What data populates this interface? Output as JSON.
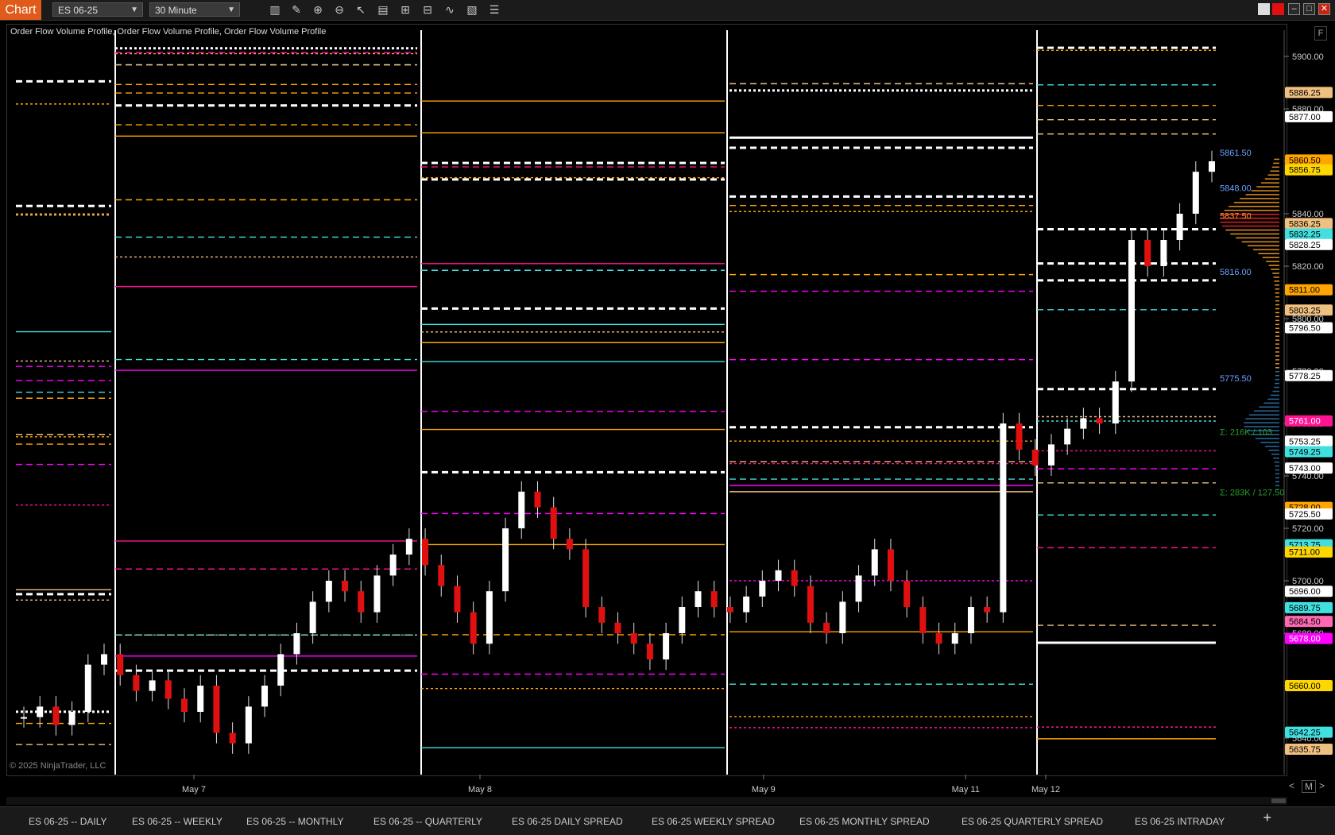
{
  "toolbar": {
    "chart_tab": "Chart",
    "instrument": "ES 06-25",
    "interval": "30 Minute",
    "icons": [
      "bars-icon",
      "pencil-icon",
      "zoom-in-icon",
      "zoom-out-icon",
      "pointer-icon",
      "data-box-icon",
      "properties-icon",
      "strategies-icon",
      "indicators-icon",
      "templates-icon",
      "list-icon"
    ]
  },
  "window": {
    "minimize": "–",
    "maximize": "□",
    "close": "✕"
  },
  "chart": {
    "indicator_label": "Order Flow Volume Profile, Order Flow Volume Profile, Order Flow Volume Profile",
    "copyright": "© 2025 NinjaTrader, LLC",
    "f_button": "F",
    "nav_left": "<",
    "nav_mode": "M",
    "nav_right": ">"
  },
  "chart_data": {
    "type": "candlestick",
    "instrument": "ES 06-25",
    "ylim": [
      5630,
      5910
    ],
    "y_ticks": [
      5900.0,
      5880.0,
      5860.0,
      5840.0,
      5820.0,
      5800.0,
      5780.0,
      5760.0,
      5740.0,
      5720.0,
      5700.0,
      5680.0,
      5660.0,
      5640.0
    ],
    "x_labels": [
      {
        "label": "May 7",
        "pos": 0.145
      },
      {
        "label": "May 8",
        "pos": 0.37
      },
      {
        "label": "May 9",
        "pos": 0.593
      },
      {
        "label": "May 11",
        "pos": 0.752
      },
      {
        "label": "May 12",
        "pos": 0.815
      }
    ],
    "price_markers": [
      {
        "value": "5886.25",
        "price": 5886.25,
        "bg": "#f0c080",
        "fg": "#000"
      },
      {
        "value": "5877.00",
        "price": 5877.0,
        "bg": "#ffffff",
        "fg": "#000"
      },
      {
        "value": "5860.50",
        "price": 5860.5,
        "bg": "#ffa500",
        "fg": "#000"
      },
      {
        "value": "5856.75",
        "price": 5856.75,
        "bg": "#ffd700",
        "fg": "#000"
      },
      {
        "value": "5836.25",
        "price": 5836.25,
        "bg": "#f0c080",
        "fg": "#000"
      },
      {
        "value": "5832.25",
        "price": 5832.25,
        "bg": "#40e0e0",
        "fg": "#000"
      },
      {
        "value": "5828.25",
        "price": 5828.25,
        "bg": "#ffffff",
        "fg": "#000"
      },
      {
        "value": "5811.00",
        "price": 5811.0,
        "bg": "#ffa500",
        "fg": "#000"
      },
      {
        "value": "5803.25",
        "price": 5803.25,
        "bg": "#f0c080",
        "fg": "#000"
      },
      {
        "value": "5796.50",
        "price": 5796.5,
        "bg": "#ffffff",
        "fg": "#000"
      },
      {
        "value": "5778.25",
        "price": 5778.25,
        "bg": "#ffffff",
        "fg": "#000"
      },
      {
        "value": "5761.00",
        "price": 5761.0,
        "bg": "#ff1493",
        "fg": "#fff"
      },
      {
        "value": "5753.25",
        "price": 5753.25,
        "bg": "#ffffff",
        "fg": "#000"
      },
      {
        "value": "5749.25",
        "price": 5749.25,
        "bg": "#40e0e0",
        "fg": "#000"
      },
      {
        "value": "5743.00",
        "price": 5743.0,
        "bg": "#ffffff",
        "fg": "#000"
      },
      {
        "value": "5728.00",
        "price": 5728.0,
        "bg": "#ffa500",
        "fg": "#000"
      },
      {
        "value": "5725.50",
        "price": 5725.5,
        "bg": "#ffffff",
        "fg": "#000"
      },
      {
        "value": "5713.75",
        "price": 5713.75,
        "bg": "#40e0e0",
        "fg": "#000"
      },
      {
        "value": "5711.00",
        "price": 5711.0,
        "bg": "#ffd700",
        "fg": "#000"
      },
      {
        "value": "5696.00",
        "price": 5696.0,
        "bg": "#ffffff",
        "fg": "#000"
      },
      {
        "value": "5689.75",
        "price": 5689.75,
        "bg": "#40e0e0",
        "fg": "#000"
      },
      {
        "value": "5684.50",
        "price": 5684.5,
        "bg": "#ff69b4",
        "fg": "#000"
      },
      {
        "value": "5678.00",
        "price": 5678.0,
        "bg": "#ff00ff",
        "fg": "#fff"
      },
      {
        "value": "5660.00",
        "price": 5660.0,
        "bg": "#ffd700",
        "fg": "#000"
      },
      {
        "value": "5642.25",
        "price": 5642.25,
        "bg": "#40e0e0",
        "fg": "#000"
      },
      {
        "value": "5635.75",
        "price": 5635.75,
        "bg": "#f0c080",
        "fg": "#000"
      }
    ],
    "profile_labels": [
      {
        "value": "5861.50",
        "price": 5861.5,
        "color": "#6aa0ff"
      },
      {
        "value": "5848.00",
        "price": 5848.0,
        "color": "#6aa0ff"
      },
      {
        "value": "5837.50",
        "price": 5837.5,
        "color": "#ff9030"
      },
      {
        "value": "5816.00",
        "price": 5816.0,
        "color": "#6aa0ff"
      },
      {
        "value": "5775.50",
        "price": 5775.5,
        "color": "#6aa0ff"
      },
      {
        "value": "Σ: 216K / 103",
        "price": 5755.0,
        "color": "#2a9a2a"
      },
      {
        "value": "Σ: 283K / 127.50",
        "price": 5732.0,
        "color": "#2a9a2a"
      }
    ],
    "candles_close_path": [
      5648,
      5652,
      5645,
      5650,
      5668,
      5672,
      5664,
      5658,
      5662,
      5655,
      5650,
      5660,
      5642,
      5638,
      5652,
      5660,
      5672,
      5680,
      5692,
      5700,
      5696,
      5688,
      5702,
      5710,
      5716,
      5706,
      5698,
      5688,
      5676,
      5696,
      5720,
      5734,
      5728,
      5716,
      5712,
      5690,
      5684,
      5680,
      5676,
      5670,
      5680,
      5690,
      5696,
      5690,
      5688,
      5694,
      5700,
      5704,
      5698,
      5684,
      5680,
      5692,
      5702,
      5712,
      5700,
      5690,
      5680,
      5676,
      5680,
      5690,
      5688,
      5760,
      5750,
      5744,
      5752,
      5758,
      5762,
      5760,
      5776,
      5830,
      5820,
      5830,
      5840,
      5856,
      5860
    ]
  },
  "tabs": [
    {
      "label": "ES 06-25 -- DAILY",
      "active": true
    },
    {
      "label": "ES 06-25 -- WEEKLY"
    },
    {
      "label": "ES 06-25 -- MONTHLY"
    },
    {
      "label": "ES 06-25 -- QUARTERLY"
    },
    {
      "label": "ES 06-25 DAILY SPREAD"
    },
    {
      "label": "ES 06-25 WEEKLY SPREAD"
    },
    {
      "label": "ES 06-25 MONTHLY SPREAD"
    },
    {
      "label": "ES 06-25 QUARTERLY SPREAD"
    },
    {
      "label": "ES 06-25 INTRADAY"
    }
  ],
  "add_tab": "+"
}
